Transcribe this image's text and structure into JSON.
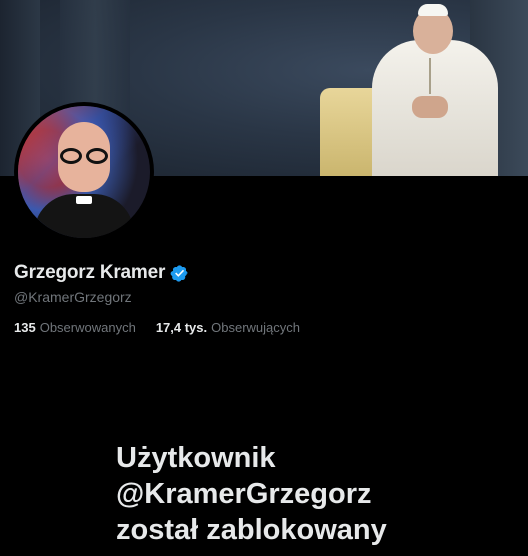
{
  "profile": {
    "display_name": "Grzegorz Kramer",
    "handle": "@KramerGrzegorz",
    "verified": true,
    "verified_color": "#1d9bf0"
  },
  "stats": [
    {
      "value": "135",
      "label": "Obserwowanych"
    },
    {
      "value": "17,4 tys.",
      "label": "Obserwujących"
    }
  ],
  "blocked_message": {
    "line1": "Użytkownik",
    "line2": "@KramerGrzegorz",
    "line3": "został zablokowany"
  },
  "colors": {
    "background": "#000000",
    "text_primary": "#e7e9ea",
    "text_secondary": "#71767b"
  }
}
